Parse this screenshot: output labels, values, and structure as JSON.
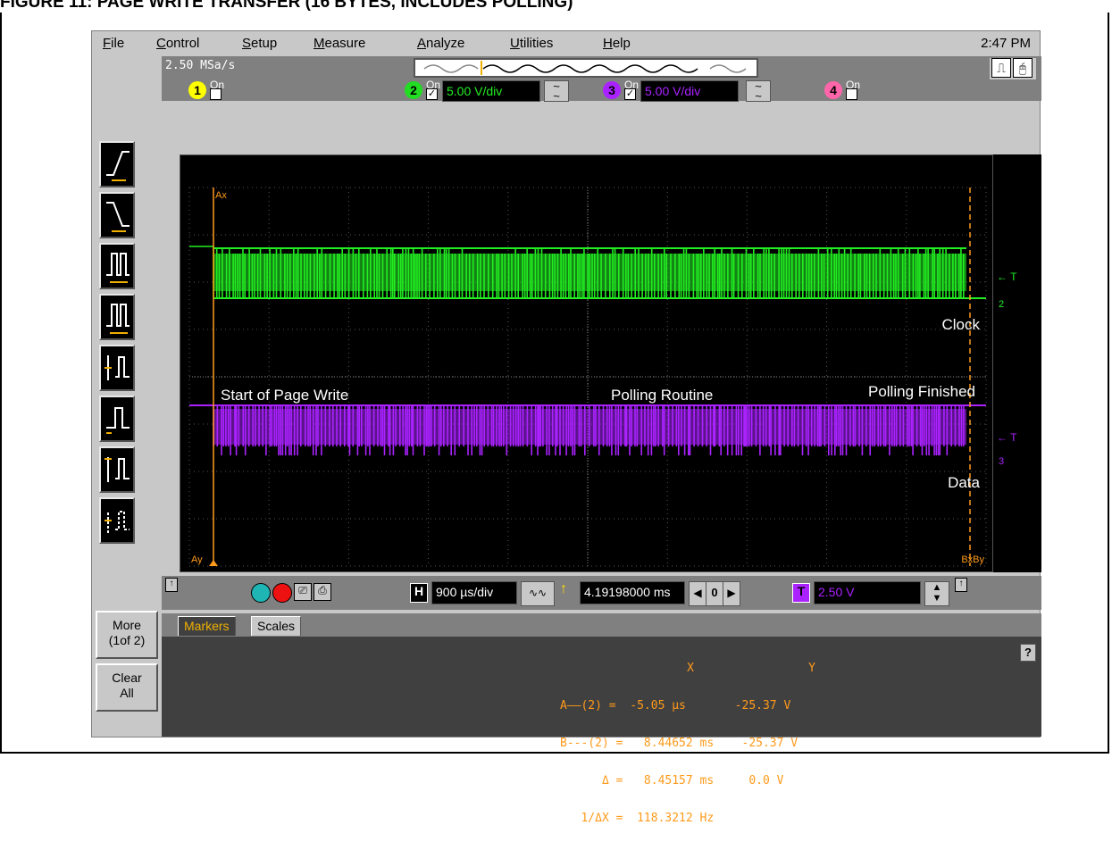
{
  "figure_title": "FIGURE 11:       PAGE WRITE TRANSFER (16 BYTES, INCLUDES POLLING)",
  "menu": [
    {
      "label": "File",
      "ul": "F",
      "rest": "ile"
    },
    {
      "label": "Control",
      "ul": "C",
      "rest": "ontrol"
    },
    {
      "label": "Setup",
      "ul": "S",
      "rest": "etup"
    },
    {
      "label": "Measure",
      "ul": "M",
      "rest": "easure"
    },
    {
      "label": "Analyze",
      "ul": "A",
      "rest": "nalyze"
    },
    {
      "label": "Utilities",
      "ul": "U",
      "rest": "tilities"
    },
    {
      "label": "Help",
      "ul": "H",
      "rest": "elp"
    }
  ],
  "clock": "2:47 PM",
  "sample_rate": "2.50 MSa/s",
  "channels": [
    {
      "num": "1",
      "on_label": "On",
      "enabled": false,
      "color": "#ffff00",
      "scale": ""
    },
    {
      "num": "2",
      "on_label": "On",
      "enabled": true,
      "color": "#22dd22",
      "scale": "5.00 V/div"
    },
    {
      "num": "3",
      "on_label": "On",
      "enabled": true,
      "color": "#aa22ff",
      "scale": "5.00 V/div"
    },
    {
      "num": "4",
      "on_label": "On",
      "enabled": false,
      "color": "#ff66aa",
      "scale": ""
    }
  ],
  "sidebar": {
    "more_label": "More\n(1of 2)",
    "more_line1": "More",
    "more_line2": "(1of 2)",
    "clear_line1": "Clear",
    "clear_line2": "All"
  },
  "waveform_labels": {
    "clock": "Clock",
    "data": "Data",
    "start": "Start of Page Write",
    "polling": "Polling Routine",
    "finished": "Polling Finished",
    "ax": "Ax",
    "ay": "Ay",
    "bxby": "BxBy",
    "t_marker": "← T",
    "ch2_ground": "2",
    "ch3_ground": "3"
  },
  "colors": {
    "ch2": "#22ee22",
    "ch3": "#aa22ff",
    "marker": "#ff9a1a",
    "grid": "#555555"
  },
  "bottom": {
    "timebase": "900 µs/div",
    "delay": "4.19198000 ms",
    "delay_step": "0",
    "trigger_level": "2.50 V",
    "h_label": "H",
    "t_label": "T"
  },
  "tabs": [
    {
      "label": "Markers",
      "active": true
    },
    {
      "label": "Scales",
      "active": false
    }
  ],
  "markers": {
    "header_x": "X",
    "header_y": "Y",
    "rows": [
      "A——(2) =  -5.05 µs       -25.37 V",
      "B---(2) =   8.44652 ms    -25.37 V",
      "      Δ =   8.45157 ms     0.0 V",
      "   1/ΔX =  118.3212 Hz"
    ]
  },
  "help": "?"
}
